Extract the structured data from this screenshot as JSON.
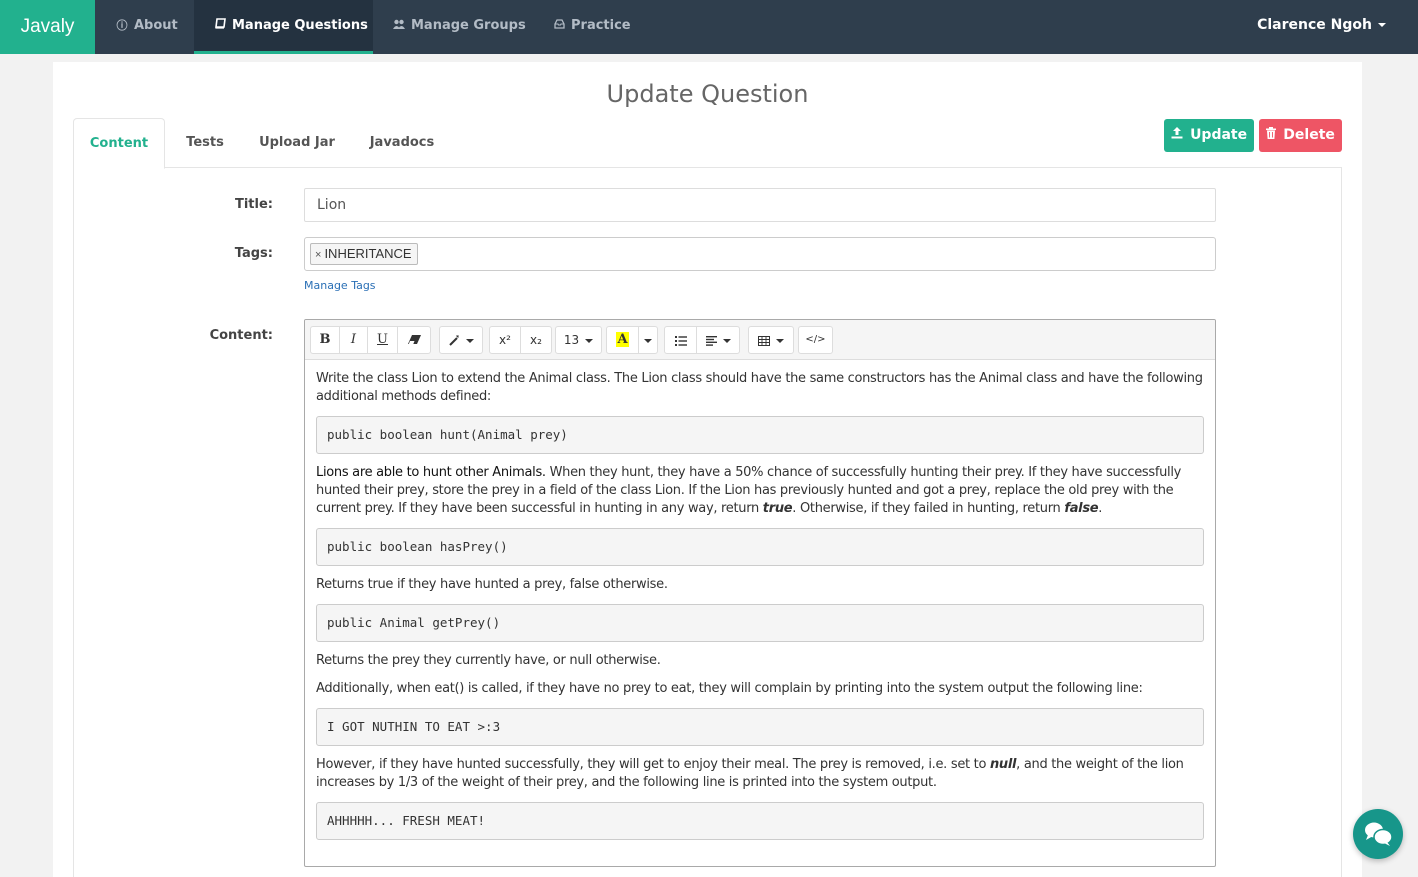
{
  "navbar": {
    "brand": "Javaly",
    "items": [
      {
        "label": "About",
        "icon": "info-circle-icon",
        "active": false
      },
      {
        "label": "Manage Questions",
        "icon": "book-icon",
        "active": true
      },
      {
        "label": "Manage Groups",
        "icon": "users-icon",
        "active": false
      },
      {
        "label": "Practice",
        "icon": "inbox-icon",
        "active": false
      }
    ],
    "user": "Clarence Ngoh"
  },
  "page": {
    "title": "Update Question",
    "tabs": [
      {
        "label": "Content",
        "active": true
      },
      {
        "label": "Tests",
        "active": false
      },
      {
        "label": "Upload Jar",
        "active": false
      },
      {
        "label": "Javadocs",
        "active": false
      }
    ],
    "buttons": {
      "update": "Update",
      "delete": "Delete"
    }
  },
  "form": {
    "title_label": "Title:",
    "title_value": "Lion",
    "tags_label": "Tags:",
    "tags": [
      "INHERITANCE"
    ],
    "tag_remove_glyph": "×",
    "manage_tags": "Manage Tags",
    "content_label": "Content:"
  },
  "toolbar": {
    "bold": "B",
    "italic": "I",
    "underline": "U",
    "font_size": "13",
    "superscript": "x²",
    "subscript": "x₂",
    "highlight": "A",
    "highlight_color": "#ffff00",
    "code_view": "</>"
  },
  "content": {
    "p1": "Write the class Lion to extend the Animal class.  The Lion class should have the same constructors has the Animal class and have the following additional methods defined:",
    "code1": "public boolean hunt(Animal prey)",
    "p2_a": "Lions are able to hunt other Animals.",
    "p2_b": " When they hunt, they have a 50% chance of successfully hunting their prey. If they have successfully hunted their prey, store the prey in a field of the class Lion. If the Lion has previously hunted and got a prey, replace the old prey with the current prey. If they have been successful in hunting in any way, return ",
    "p2_true": "true",
    "p2_c": ". Otherwise, if they failed in hunting, return ",
    "p2_false": "false",
    "p2_d": ".",
    "code2": "public boolean hasPrey()",
    "p3": "Returns true if they have hunted a prey, false otherwise.",
    "code3": "public Animal getPrey()",
    "p4": "Returns the prey they currently have, or null otherwise.",
    "p5": "Additionally, when eat() is called, if they have no prey to eat, they will complain by printing into the system output the following line:",
    "code4": "I GOT NUTHIN TO EAT >:3",
    "p6_a": "However, if they have hunted successfully, they will get to enjoy their meal. The prey is removed, i.e. set to ",
    "p6_null": "null",
    "p6_b": ", and the weight of the lion increases by 1/3 of the weight of their prey, and the following line is printed into the system output.",
    "code5": "AHHHHH... FRESH MEAT!"
  },
  "colors": {
    "brand": "#22b18e",
    "navbar": "#2f3e4d",
    "danger": "#ee5565",
    "chat": "#17968a"
  }
}
